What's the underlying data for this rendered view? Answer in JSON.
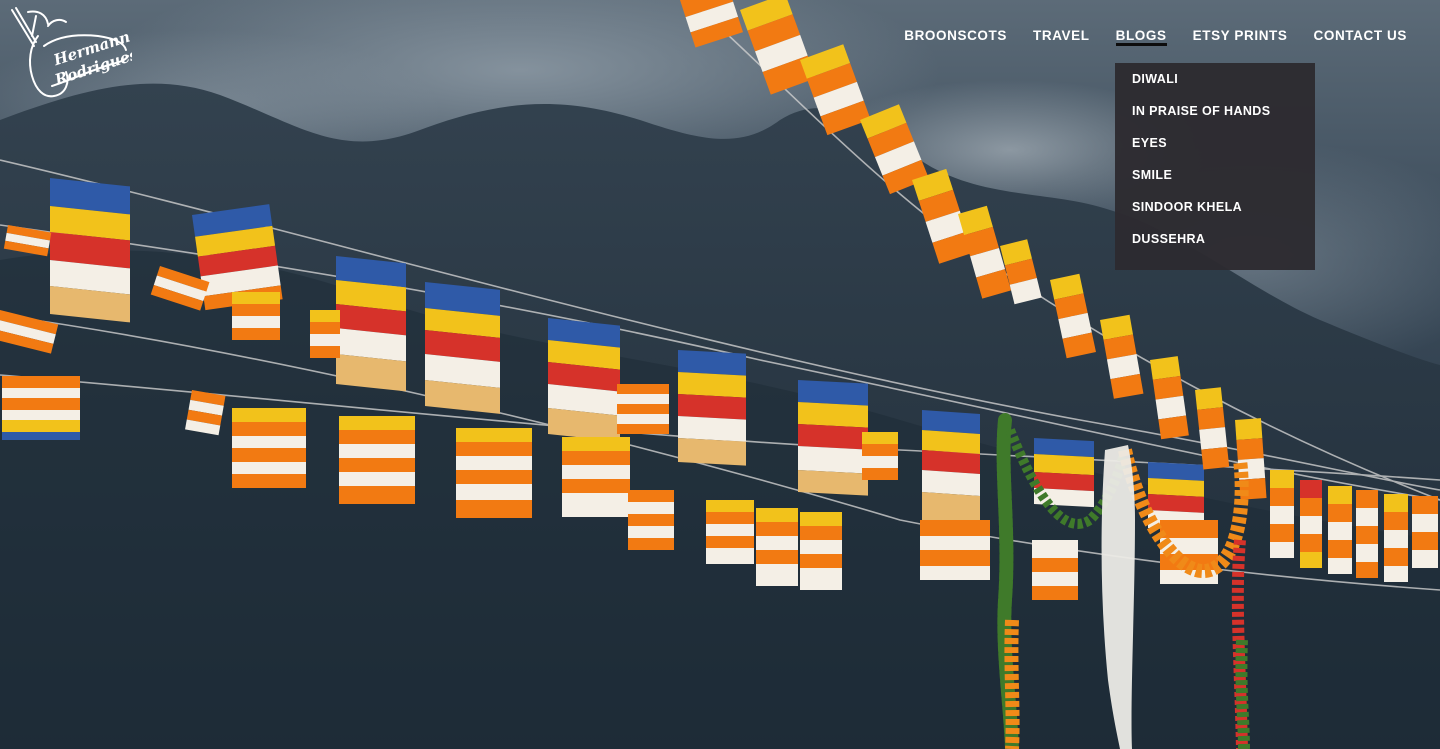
{
  "logo": {
    "text_line1": "Hermann",
    "text_line2": "Rodrigues"
  },
  "nav": {
    "items": [
      {
        "label": "BROONSCOTS"
      },
      {
        "label": "TRAVEL"
      },
      {
        "label": "BLOGS"
      },
      {
        "label": "ETSY PRINTS"
      },
      {
        "label": "CONTACT US"
      }
    ],
    "active_item": "BLOGS"
  },
  "blogs_dropdown": {
    "items": [
      {
        "label": "DIWALI"
      },
      {
        "label": "IN PRAISE OF HANDS"
      },
      {
        "label": "EYES"
      },
      {
        "label": "SMILE"
      },
      {
        "label": "SINDOOR KHELA"
      },
      {
        "label": "DUSSEHRA"
      }
    ]
  },
  "hero": {
    "subject": "Buddhist prayer flags strung across a cloudy mountain sky",
    "colors": {
      "sky": "#2e3d4c",
      "mountain": "#263442",
      "flag_blue": "#2f5aa8",
      "flag_yellow": "#f2c21b",
      "flag_red": "#d6322a",
      "flag_white": "#f4efe6",
      "flag_orange": "#f27a12",
      "garland_green": "#3f7a2a",
      "garland_orange": "#f08a18"
    }
  }
}
